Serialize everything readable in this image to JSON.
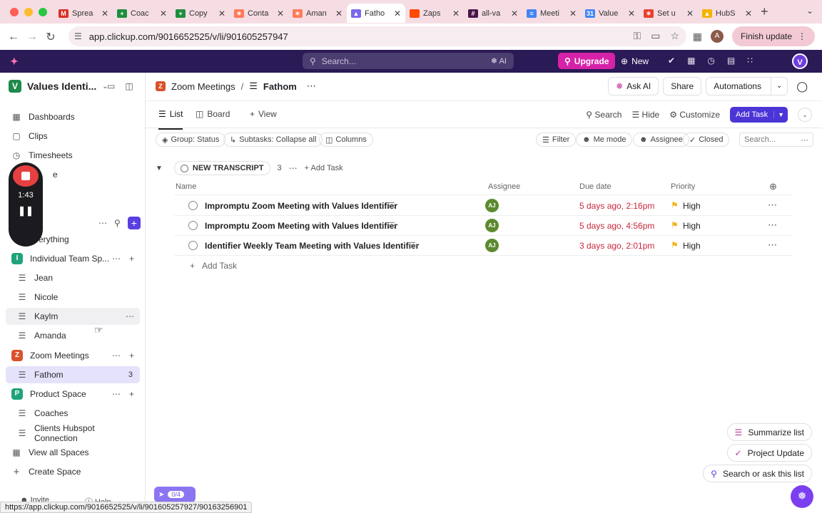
{
  "browser": {
    "tabs": [
      {
        "label": "Sprea",
        "icon": "gmail-icon",
        "color": "#d93025",
        "glyph": "M"
      },
      {
        "label": "Coac",
        "icon": "sheets-icon",
        "color": "#1e8e3e",
        "glyph": "+"
      },
      {
        "label": "Copy",
        "icon": "sheets-icon",
        "color": "#1e8e3e",
        "glyph": "+"
      },
      {
        "label": "Conta",
        "icon": "hubspot-icon",
        "color": "#ff7a59",
        "glyph": "✶"
      },
      {
        "label": "Aman",
        "icon": "hubspot-icon",
        "color": "#ff7a59",
        "glyph": "✶"
      },
      {
        "label": "Fatho",
        "icon": "clickup-icon",
        "color": "#7b68ee",
        "glyph": "▲"
      },
      {
        "label": "Zaps",
        "icon": "zapier-icon",
        "color": "#ff4a00",
        "glyph": ""
      },
      {
        "label": "all-va",
        "icon": "slack-icon",
        "color": "#4a154b",
        "glyph": "#"
      },
      {
        "label": "Meeti",
        "icon": "docs-icon",
        "color": "#4285f4",
        "glyph": "≡"
      },
      {
        "label": "Value",
        "icon": "calendar-icon",
        "color": "#4285f4",
        "glyph": "31"
      },
      {
        "label": "Set u",
        "icon": "hubspot-icon",
        "color": "#e8412c",
        "glyph": "✶"
      },
      {
        "label": "HubS",
        "icon": "drive-icon",
        "color": "#f4b400",
        "glyph": "▲"
      }
    ],
    "active_tab_index": 5,
    "url": "app.clickup.com/9016652525/v/li/901605257947",
    "profile_initial": "A",
    "finish_update_label": "Finish update"
  },
  "clickup_top": {
    "search_placeholder": "Search...",
    "ai_label": "AI",
    "upgrade_label": "Upgrade",
    "new_label": "New",
    "avatar_initial": "V"
  },
  "sidebar": {
    "workspace_initial": "V",
    "workspace_name": "Values Identi...",
    "nav": [
      {
        "label": "Dashboards",
        "icon": "dashboard-icon",
        "glyph": "▦"
      },
      {
        "label": "Clips",
        "icon": "clips-icon",
        "glyph": "▢"
      },
      {
        "label": "Timesheets",
        "icon": "timesheets-icon",
        "glyph": "◷"
      },
      {
        "label": "e",
        "icon": "more-nav-icon",
        "glyph": ""
      }
    ],
    "everything_label": "Everything",
    "spaces": [
      {
        "label": "Individual Team Sp...",
        "initial": "I",
        "color": "#1fa37a"
      },
      {
        "label": "Zoom Meetings",
        "initial": "Z",
        "color": "#d9522a"
      },
      {
        "label": "Product Space",
        "initial": "P",
        "color": "#1fa37a"
      }
    ],
    "individual_lists": [
      "Jean",
      "Nicole",
      "Kaylm",
      "Amanda"
    ],
    "zoom_lists": [
      {
        "label": "Fathom",
        "count": "3"
      }
    ],
    "product_lists": [
      "Coaches",
      "Clients Hubspot Connection"
    ],
    "view_all_spaces": "View all Spaces",
    "create_space": "Create Space",
    "invite_label": "Invite",
    "help_label": "Help"
  },
  "recorder": {
    "time": "1:43"
  },
  "header": {
    "crumb_space": "Zoom Meetings",
    "crumb_space_initial": "Z",
    "crumb_list": "Fathom",
    "ask_ai": "Ask AI",
    "share": "Share",
    "automations": "Automations"
  },
  "views": {
    "list": "List",
    "board": "Board",
    "add_view": "View",
    "search": "Search",
    "hide": "Hide",
    "customize": "Customize",
    "add_task": "Add Task"
  },
  "filters": {
    "group": "Group: Status",
    "subtasks": "Subtasks: Collapse all",
    "columns": "Columns",
    "filter": "Filter",
    "me_mode": "Me mode",
    "assignee": "Assignee",
    "closed": "Closed",
    "search_placeholder": "Search..."
  },
  "group": {
    "status": "NEW TRANSCRIPT",
    "count": "3",
    "add_task": "Add Task"
  },
  "table": {
    "columns": {
      "name": "Name",
      "assignee": "Assignee",
      "due": "Due date",
      "priority": "Priority"
    },
    "rows": [
      {
        "name": "Impromptu Zoom Meeting with Values Identifier",
        "assignee": "AJ",
        "due": "5 days ago, 2:16pm",
        "priority": "High"
      },
      {
        "name": "Impromptu Zoom Meeting with Values Identifier",
        "assignee": "AJ",
        "due": "5 days ago, 4:56pm",
        "priority": "High"
      },
      {
        "name": "Identifier Weekly Team Meeting with Values Identifier",
        "assignee": "AJ",
        "due": "3 days ago, 2:01pm",
        "priority": "High"
      }
    ],
    "add_task": "Add Task"
  },
  "floating": {
    "summarize": "Summarize list",
    "project_update": "Project Update",
    "search_ask": "Search or ask this list",
    "progress": "0/4"
  },
  "statusbar_url": "https://app.clickup.com/9016652525/v/li/901605257927/90163256901",
  "colors": {
    "accent": "#4b35d6",
    "overdue": "#c8283c",
    "priority_high": "#f2b51b",
    "topbar": "#2a1a55"
  }
}
